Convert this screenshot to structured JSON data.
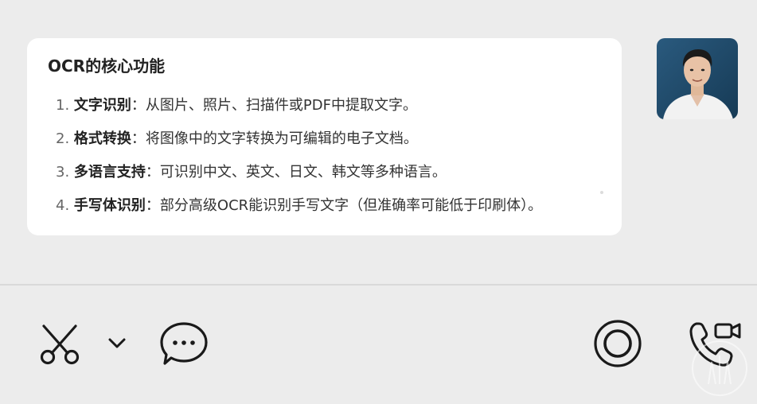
{
  "message": {
    "title": "OCR的核心功能",
    "features": [
      {
        "number": "1.",
        "term": "文字识别",
        "description": "：从图片、照片、扫描件或PDF中提取文字。"
      },
      {
        "number": "2.",
        "term": "格式转换",
        "description": "：将图像中的文字转换为可编辑的电子文档。"
      },
      {
        "number": "3.",
        "term": "多语言支持",
        "description": "：可识别中文、英文、日文、韩文等多种语言。"
      },
      {
        "number": "4.",
        "term": "手写体识别",
        "description": "：部分高级OCR能识别手写文字（但准确率可能低于印刷体）。"
      }
    ]
  },
  "icons": {
    "screenshot": "scissors-icon",
    "screenshot_menu": "chevron-down-icon",
    "chat": "chat-bubble-icon",
    "record": "record-icon",
    "call": "phone-video-icon"
  },
  "colors": {
    "background": "#ececec",
    "bubble": "#ffffff",
    "icon": "#1a1a1a",
    "avatar_bg": "#1f4a6a"
  }
}
